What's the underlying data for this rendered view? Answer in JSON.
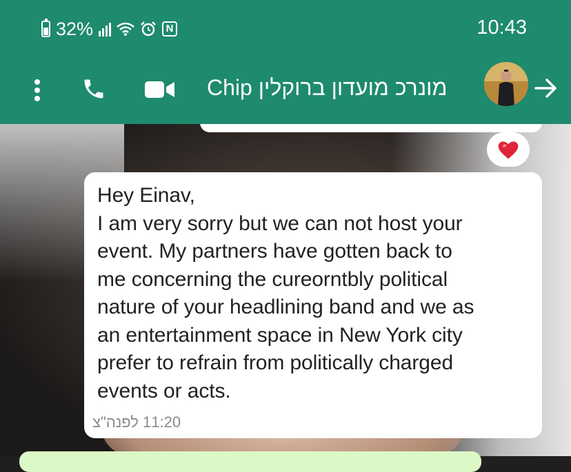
{
  "status_bar": {
    "battery_percent": "32%",
    "time": "10:43",
    "icons": [
      "battery-icon",
      "signal-icon",
      "wifi-icon",
      "alarm-icon",
      "nfc-icon"
    ]
  },
  "app_bar": {
    "title": "מונרכ מועדון ברוקלין Chip",
    "icons": [
      "more-vert-icon",
      "phone-icon",
      "video-icon",
      "avatar",
      "arrow-right-icon"
    ]
  },
  "chat": {
    "message": {
      "text": "Hey Einav,\nI am very sorry but we can not host your\nevent. My partners have gotten back to\nme concerning the cureorntbly political\nnature of your headlining band and we as\nan entertainment space in New York city\nprefer to refrain from politically charged\nevents or acts.",
      "timestamp": "11:20 לפנה\"צ",
      "reaction": "❤️"
    }
  },
  "colors": {
    "header": "#1e8a6e",
    "bubble": "#ffffff",
    "heart": "#e0243a"
  }
}
